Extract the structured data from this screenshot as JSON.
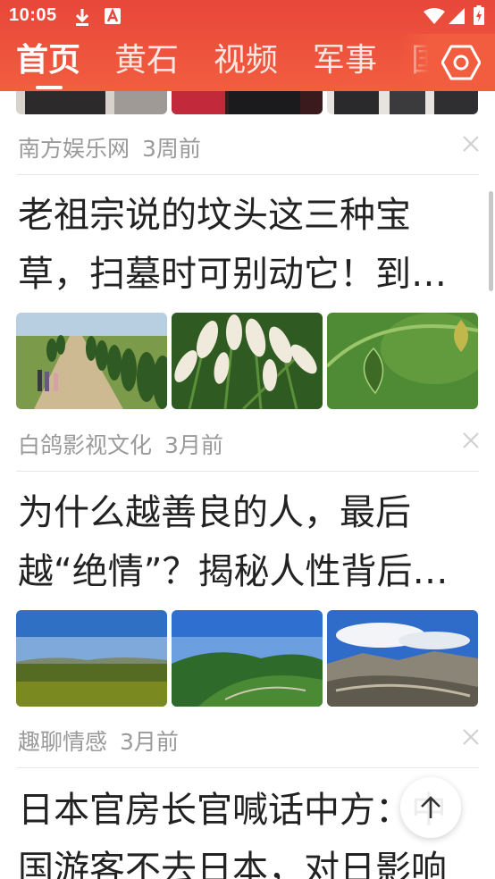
{
  "status_bar": {
    "time": "10:05",
    "icons": [
      "download-icon",
      "app-notification-icon",
      "wifi-icon",
      "signal-icon",
      "battery-charging-icon"
    ]
  },
  "tabs": [
    {
      "label": "首页",
      "active": true
    },
    {
      "label": "黄石",
      "active": false
    },
    {
      "label": "视频",
      "active": false
    },
    {
      "label": "军事",
      "active": false
    },
    {
      "label": "国",
      "active": false
    }
  ],
  "header": {
    "settings_icon": "hexagon-settings-icon",
    "accent": "#ee4f3d"
  },
  "feed": {
    "partial_item": {
      "source": "南方娱乐网",
      "time": "3周前"
    },
    "items": [
      {
        "title": "老祖宗说的坟头这三种宝草，扫墓时可别动它！到底是为什么？",
        "source": "白鸽影视文化",
        "time": "3月前",
        "images": [
          "tree-lined-dirt-road-photo",
          "pampas-grass-photo",
          "green-lantern-pod-photo"
        ]
      },
      {
        "title": "为什么越善良的人，最后越“绝情”？揭秘人性背后的真相",
        "source": "趣聊情感",
        "time": "3月前",
        "images": [
          "grassland-meadow-photo",
          "green-hills-photo",
          "canyon-landscape-photo"
        ]
      },
      {
        "title": "日本官房长官喊话中方：中国游客不去日本，对日影响",
        "source": "",
        "time": "",
        "images": []
      }
    ]
  },
  "floating": {
    "back_to_top_icon": "arrow-up-icon"
  }
}
